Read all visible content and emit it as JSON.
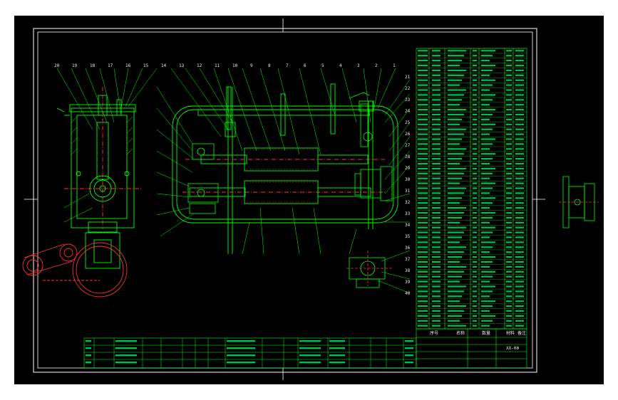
{
  "drawing": {
    "colors": {
      "background": "#000000",
      "frame": "#ffffff",
      "geometry": "#00ff00",
      "table_grid": "#00ff00",
      "centerline": "#ff3030",
      "table_text": "#00ff66",
      "cyan_detail": "#00e5ff"
    },
    "bom_header": {
      "seq": "序号",
      "name": "名称",
      "qty": "数量",
      "material": "材料",
      "note": "备注"
    },
    "title_block": {
      "code": "XX-00"
    },
    "callouts_top": [
      "20",
      "19",
      "18",
      "17",
      "16",
      "15",
      "14",
      "13",
      "12",
      "11",
      "10",
      "9",
      "8",
      "7",
      "6",
      "5",
      "4",
      "3",
      "2",
      "1"
    ],
    "callouts_right": [
      "21",
      "22",
      "23",
      "24",
      "25",
      "26",
      "27",
      "28",
      "29",
      "30",
      "31",
      "32",
      "33",
      "34",
      "35",
      "36",
      "37",
      "38",
      "39",
      "40"
    ]
  }
}
